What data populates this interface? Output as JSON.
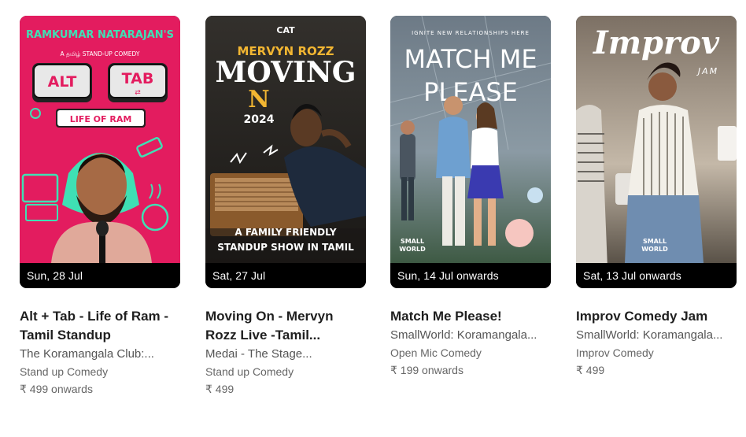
{
  "events": [
    {
      "date": "Sun, 28 Jul",
      "title": "Alt + Tab - Life of Ram - Tamil Standup",
      "venue": "The Koramangala Club:...",
      "genre": "Stand up Comedy",
      "price": "₹ 499 onwards",
      "poster": {
        "top_text": "RAMKUMAR NATARAJAN'S",
        "sub_text": "A தமிழ் STAND-UP COMEDY",
        "key_left": "ALT",
        "key_right": "TAB",
        "banner": "LIFE OF RAM",
        "bg": "#e31c5f"
      }
    },
    {
      "date": "Sat, 27 Jul",
      "title": "Moving On - Mervyn Rozz Live -Tamil...",
      "venue": "Medai - The Stage...",
      "genre": "Stand up Comedy",
      "price": "₹ 499",
      "poster": {
        "logo": "CAT",
        "name": "MERVYN ROZZ",
        "word1": "MOVING",
        "word2": "N",
        "year": "2024",
        "tag1": "A FAMILY FRIENDLY",
        "tag2": "STANDUP SHOW IN TAMIL"
      }
    },
    {
      "date": "Sun, 14 Jul onwards",
      "title": "Match Me Please!",
      "venue": "SmallWorld: Koramangala...",
      "genre": "Open Mic Comedy",
      "price": "₹ 199 onwards",
      "poster": {
        "kicker": "IGNITE NEW RELATIONSHIPS HERE",
        "line1": "MATCH ME",
        "line2": "PLEASE",
        "brand1": "SMALL",
        "brand2": "WORLD"
      }
    },
    {
      "date": "Sat, 13 Jul onwards",
      "title": "Improv Comedy Jam",
      "venue": "SmallWorld: Koramangala...",
      "genre": "Improv Comedy",
      "price": "₹ 499",
      "poster": {
        "line1": "Improv",
        "line2": "JAM",
        "brand1": "SMALL",
        "brand2": "WORLD"
      }
    }
  ]
}
